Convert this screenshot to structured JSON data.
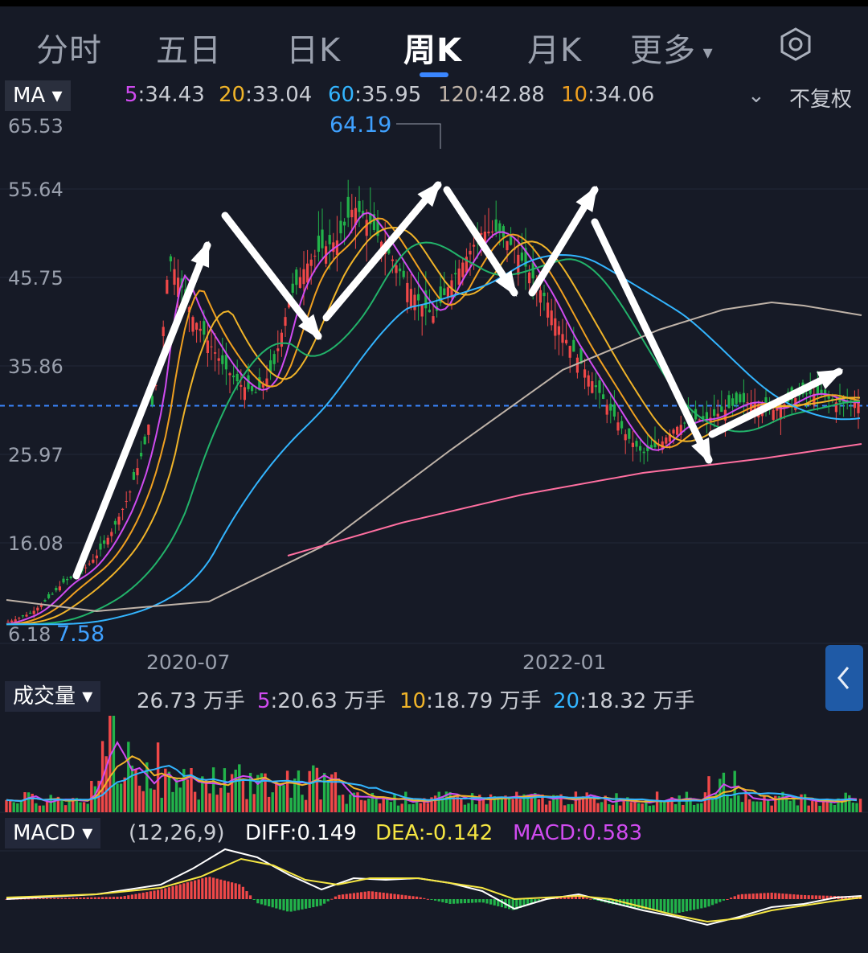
{
  "tabs": [
    {
      "label": "分时",
      "x": 45
    },
    {
      "label": "五日",
      "x": 194
    },
    {
      "label": "日K",
      "x": 356
    },
    {
      "label": "周K",
      "x": 502,
      "active": true
    },
    {
      "label": "月K",
      "x": 656
    },
    {
      "label": "更多",
      "x": 784
    }
  ],
  "more_arrow": "▾",
  "ma_bar": {
    "button": "MA ▾",
    "items": [
      {
        "key": "5",
        "value": ":34.43",
        "color": "#d04bf0"
      },
      {
        "key": "20",
        "value": ":33.04",
        "color": "#f0b429"
      },
      {
        "key": "60",
        "value": ":35.95",
        "color": "#33b5ff"
      },
      {
        "key": "120",
        "value": ":42.88",
        "color": "#bfb3a8"
      },
      {
        "key": "10",
        "value": ":34.06",
        "color": "#f0a020"
      }
    ],
    "adjust": "不复权"
  },
  "price_axis": [
    "65.53",
    "55.64",
    "45.75",
    "35.86",
    "25.97",
    "16.08",
    "6.18"
  ],
  "max_label": "64.19",
  "min_label": "7.58",
  "date_axis": [
    "2020-07",
    "2022-01"
  ],
  "volume_bar": {
    "button": "成交量 ▾",
    "current": "26.73 万手",
    "items": [
      {
        "key": "5",
        "value": ":20.63 万手",
        "color": "#d04bf0"
      },
      {
        "key": "10",
        "value": ":18.79 万手",
        "color": "#f0b429"
      },
      {
        "key": "20",
        "value": ":18.32 万手",
        "color": "#33b5ff"
      }
    ]
  },
  "macd_bar": {
    "button": "MACD ▾",
    "params": "(12,26,9)",
    "diff": "DIFF:0.149",
    "dea": "DEA:-0.142",
    "macd": "MACD:0.583"
  },
  "chart_data": {
    "type": "candlestick",
    "y_range": [
      6.18,
      65.53
    ],
    "current_price": 32.6,
    "close_path": [
      [
        0,
        7.0
      ],
      [
        20,
        7.6
      ],
      [
        40,
        8.4
      ],
      [
        60,
        10
      ],
      [
        80,
        12
      ],
      [
        100,
        13
      ],
      [
        120,
        15
      ],
      [
        140,
        18
      ],
      [
        160,
        22
      ],
      [
        180,
        28
      ],
      [
        200,
        38
      ],
      [
        210,
        50
      ],
      [
        220,
        48
      ],
      [
        240,
        43
      ],
      [
        260,
        40
      ],
      [
        280,
        37
      ],
      [
        300,
        35
      ],
      [
        320,
        34
      ],
      [
        340,
        37
      ],
      [
        360,
        45
      ],
      [
        380,
        49
      ],
      [
        400,
        51
      ],
      [
        420,
        52
      ],
      [
        440,
        56
      ],
      [
        460,
        54
      ],
      [
        480,
        51
      ],
      [
        500,
        48
      ],
      [
        520,
        45
      ],
      [
        540,
        43
      ],
      [
        560,
        47
      ],
      [
        580,
        50
      ],
      [
        600,
        53
      ],
      [
        620,
        53
      ],
      [
        640,
        51
      ],
      [
        660,
        48
      ],
      [
        680,
        45
      ],
      [
        700,
        41
      ],
      [
        720,
        38
      ],
      [
        740,
        35
      ],
      [
        760,
        32
      ],
      [
        780,
        29
      ],
      [
        800,
        27
      ],
      [
        820,
        28
      ],
      [
        840,
        30
      ],
      [
        860,
        31
      ],
      [
        880,
        31
      ],
      [
        900,
        32
      ],
      [
        920,
        33
      ],
      [
        940,
        33
      ],
      [
        960,
        32
      ],
      [
        980,
        33
      ],
      [
        1000,
        34
      ],
      [
        1020,
        34
      ],
      [
        1040,
        33
      ]
    ]
  }
}
